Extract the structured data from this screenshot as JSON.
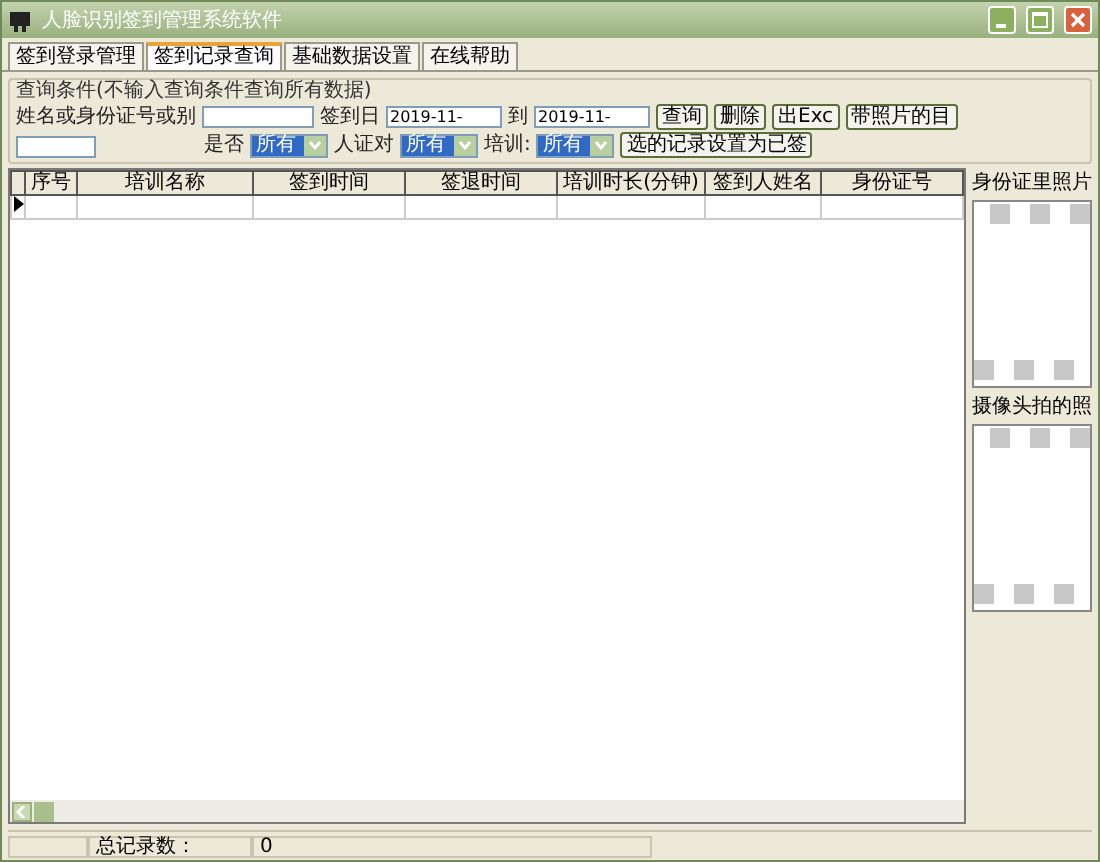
{
  "window": {
    "title": "人脸识别签到管理系统软件"
  },
  "tabs": [
    {
      "label": "签到登录管理",
      "selected": false
    },
    {
      "label": "签到记录查询",
      "selected": true
    },
    {
      "label": "基础数据设置",
      "selected": false
    },
    {
      "label": "在线帮助",
      "selected": false
    }
  ],
  "query": {
    "legend": "查询条件(不输入查询条件查询所有数据)",
    "name_label": "姓名或身份证号或别",
    "date_from_label": "签到日",
    "date_from": "2019-11-",
    "date_to_label": "到",
    "date_to": "2019-11-",
    "filters": [
      {
        "label": "是否",
        "value": "所有"
      },
      {
        "label": "人证对",
        "value": "所有"
      },
      {
        "label": "培训:",
        "value": "所有"
      }
    ],
    "buttons": [
      {
        "label": "查询"
      },
      {
        "label": "删除"
      },
      {
        "label": "出Exc"
      },
      {
        "label": "带照片的目"
      }
    ],
    "mark_button": "选的记录设置为已签"
  },
  "table": {
    "columns": [
      "序号",
      "培训名称",
      "签到时间",
      "签退时间",
      "培训时长(分钟)",
      "签到人姓名",
      "身份证号"
    ],
    "rows": [
      {
        "current": true
      }
    ]
  },
  "photos": [
    {
      "title": "身份证里照片"
    },
    {
      "title": "摄像头拍的照"
    }
  ],
  "status_bar": {
    "label": "总记录数：",
    "value": "0"
  }
}
